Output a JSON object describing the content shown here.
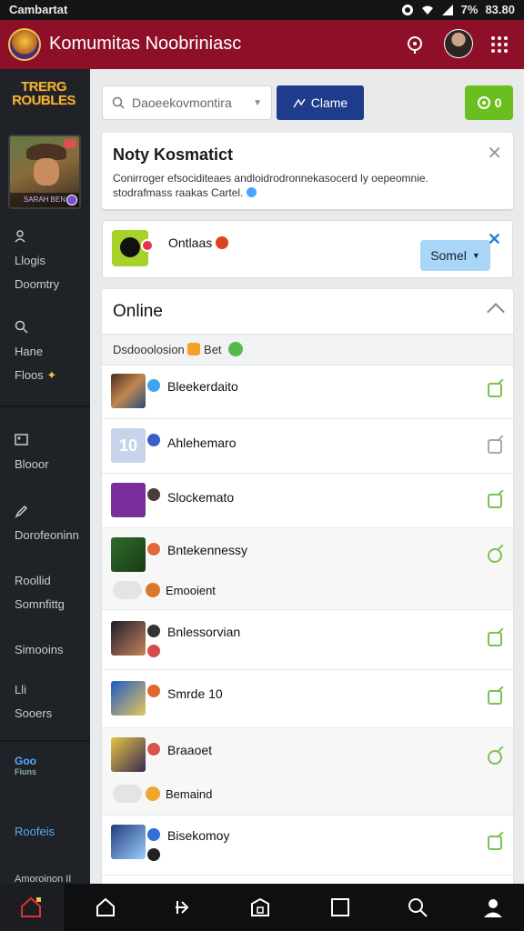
{
  "status_bar": {
    "carrier": "Cambartat",
    "battery": "7%",
    "time": "83.80"
  },
  "header": {
    "title": "Komumitas Noobriniasc"
  },
  "sidebar": {
    "logo": "TRERG ROUBLES",
    "game_card_label": "SARAH BEN",
    "items": [
      {
        "label1": "Llogis",
        "label2": "Doomtry"
      },
      {
        "label1": "Hane",
        "label2": "Floos"
      },
      {
        "label1": "Blooor",
        "label2": ""
      },
      {
        "label1": "Dorofeoninn",
        "label2": ""
      },
      {
        "label1": "Roollid",
        "label2": "Somnfittg"
      },
      {
        "label1": "Simooins",
        "label2": ""
      },
      {
        "label1": "Lli",
        "label2": "Sooers"
      },
      {
        "label1": "Roofeis",
        "label2": ""
      },
      {
        "label1": "Amoroinon II",
        "label2": ""
      }
    ],
    "chat_label": "Goo",
    "chat_sub": "Fiuns"
  },
  "toolbar": {
    "search_placeholder": "Daoeekovmontira",
    "create_label": "Clame",
    "count_label": "0"
  },
  "notification": {
    "title": "Noty Kosmatict",
    "body": "Conirroger efsociditeaes andloidrodronnekasocerd ly oepeomnie. stodrafmass raakas Cartel."
  },
  "status_card": {
    "label": "Ontlaas",
    "select_label": "Somel"
  },
  "online": {
    "title": "Online",
    "subheader": "Dsdooolosion",
    "subheader_tag": "Bet",
    "rows": [
      {
        "name": "Bleekerdaito"
      },
      {
        "name": "Ahlehemaro"
      },
      {
        "name": "Slockemato"
      },
      {
        "name": "Bntekennessy",
        "sub": "Emooient"
      },
      {
        "name": "Bnlessorvian"
      },
      {
        "name": "Smrde 10"
      },
      {
        "name": "Braaoet",
        "sub": "Bemaind"
      },
      {
        "name": "Bisekomoy"
      }
    ]
  },
  "colors": {
    "header": "#8e1028",
    "sidebar": "#1f2227",
    "accent_blue": "#1f3c8c",
    "accent_green": "#6abf20"
  }
}
